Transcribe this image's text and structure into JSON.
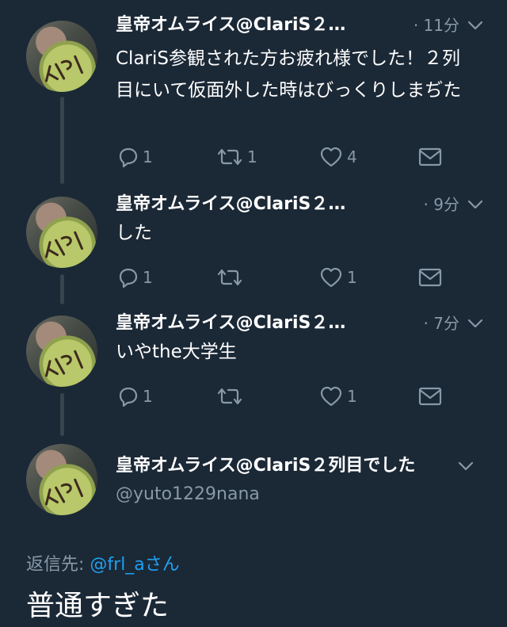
{
  "tweets": [
    {
      "name": "皇帝オムライス@ClariS２…",
      "time": "· 11分",
      "text": "ClariS参観された方お疲れ様でした！２列目にいて仮面外した時はびっくりしまぢた",
      "replies": "1",
      "retweets": "1",
      "likes": "4"
    },
    {
      "name": "皇帝オムライス@ClariS２…",
      "time": "· 9分",
      "text": "した",
      "replies": "1",
      "retweets": "",
      "likes": "1"
    },
    {
      "name": "皇帝オムライス@ClariS２…",
      "time": "· 7分",
      "text": "いやthe大学生",
      "replies": "1",
      "retweets": "",
      "likes": "1"
    }
  ],
  "focused_tweet": {
    "name": "皇帝オムライス@ClariS２列目でした",
    "handle": "@yuto1229nana",
    "reply_to_label": "返信先: ",
    "reply_to_mention": "@frl_a",
    "reply_to_suffix": "さん",
    "text": "普通すぎた"
  },
  "colors": {
    "background": "#1b2836",
    "text_primary": "#ffffff",
    "text_secondary": "#8899a6",
    "link": "#1da1f2",
    "thread_line": "#38444d"
  },
  "icons": {
    "reply": "reply-icon",
    "retweet": "retweet-icon",
    "like": "heart-icon",
    "dm": "envelope-icon",
    "more": "chevron-down-icon"
  }
}
